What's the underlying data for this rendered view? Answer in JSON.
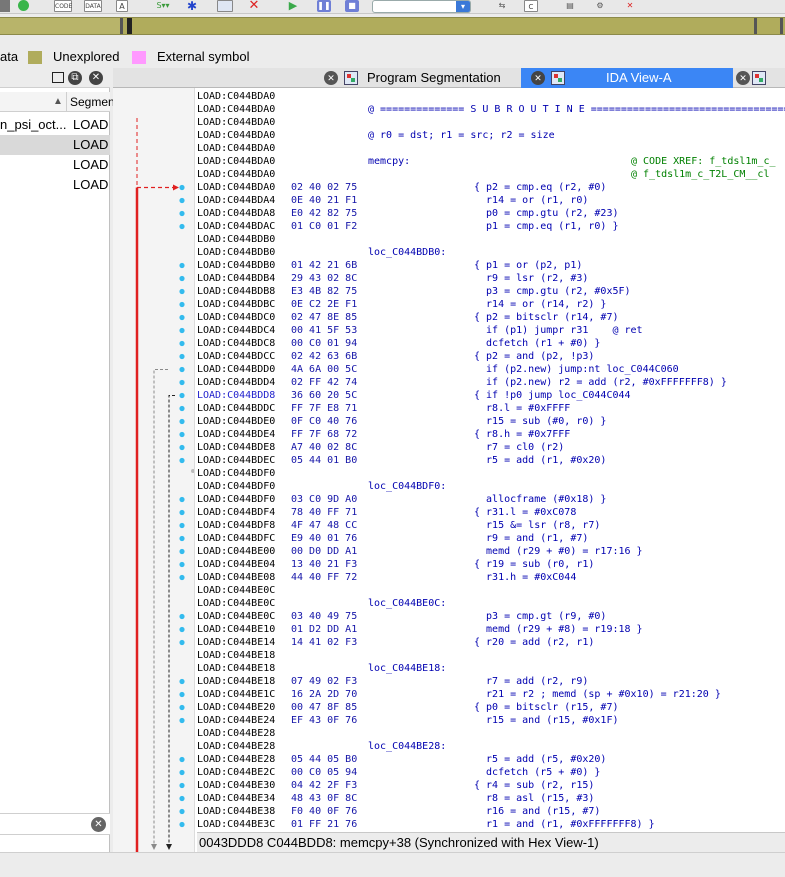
{
  "toolbar": {
    "icons": [
      "app-icon",
      "green-circle-icon",
      "code-icon",
      "data-icon",
      "text-icon",
      "script-dropdown-icon",
      "cross-ref-icon",
      "graph-icon",
      "stop-icon",
      "play-icon",
      "pause-icon",
      "pause-alt-icon",
      "debugger-dropdown",
      "attach-icon",
      "copy-icon",
      "notes-icon",
      "settings-icon"
    ],
    "code_label": "CODE",
    "data_label": "DATA",
    "debugger_value": ""
  },
  "legend": {
    "items": [
      {
        "label": "ata",
        "color": ""
      },
      {
        "label": "Unexplored",
        "color": "#b0ac5c"
      },
      {
        "label": "External symbol",
        "color": "#ff99ff"
      }
    ]
  },
  "segments_pane": {
    "col_name": "",
    "col_segment": "Segmen",
    "rows": [
      {
        "name": "n_psi_oct...",
        "type": "LOAD",
        "selected": false
      },
      {
        "name": "",
        "type": "LOAD",
        "selected": true
      },
      {
        "name": "",
        "type": "LOAD",
        "selected": false
      },
      {
        "name": "",
        "type": "LOAD",
        "selected": false
      }
    ]
  },
  "tabs": [
    {
      "label": "Program Segmentation",
      "active": false
    },
    {
      "label": "IDA View-A",
      "active": true
    },
    {
      "label": "",
      "active": false
    }
  ],
  "listing": [
    {
      "addr": "LOAD:C044BDA0",
      "bytes": "",
      "label": "",
      "instr": "",
      "comment": ""
    },
    {
      "addr": "LOAD:C044BDA0",
      "bytes": "",
      "label": "@ ============== S U B R O U T I N E =======================================",
      "instr": "",
      "comment": ""
    },
    {
      "addr": "LOAD:C044BDA0",
      "bytes": "",
      "label": "",
      "instr": "",
      "comment": ""
    },
    {
      "addr": "LOAD:C044BDA0",
      "bytes": "",
      "label": "@ r0 = dst; r1 = src; r2 = size",
      "instr": "",
      "comment": ""
    },
    {
      "addr": "LOAD:C044BDA0",
      "bytes": "",
      "label": "",
      "instr": "",
      "comment": ""
    },
    {
      "addr": "LOAD:C044BDA0",
      "bytes": "",
      "label": "memcpy:",
      "instr": "",
      "comment": "@ CODE XREF: f_tdsl1m_c_"
    },
    {
      "addr": "LOAD:C044BDA0",
      "bytes": "",
      "label": "",
      "instr": "",
      "comment": "@ f_tdsl1m_c_T2L_CM__cl"
    },
    {
      "addr": "LOAD:C044BDA0",
      "bytes": "02 40 02 75",
      "label": "",
      "instr": "{ p2 = cmp.eq (r2, #0)",
      "comment": ""
    },
    {
      "addr": "LOAD:C044BDA4",
      "bytes": "0E 40 21 F1",
      "label": "",
      "instr": "  r14 = or (r1, r0)",
      "comment": ""
    },
    {
      "addr": "LOAD:C044BDA8",
      "bytes": "E0 42 82 75",
      "label": "",
      "instr": "  p0 = cmp.gtu (r2, #23)",
      "comment": ""
    },
    {
      "addr": "LOAD:C044BDAC",
      "bytes": "01 C0 01 F2",
      "label": "",
      "instr": "  p1 = cmp.eq (r1, r0) }",
      "comment": ""
    },
    {
      "addr": "LOAD:C044BDB0",
      "bytes": "",
      "label": "",
      "instr": "",
      "comment": ""
    },
    {
      "addr": "LOAD:C044BDB0",
      "bytes": "",
      "label": "loc_C044BDB0:",
      "instr": "",
      "comment": ""
    },
    {
      "addr": "LOAD:C044BDB0",
      "bytes": "01 42 21 6B",
      "label": "",
      "instr": "{ p1 = or (p2, p1)",
      "comment": ""
    },
    {
      "addr": "LOAD:C044BDB4",
      "bytes": "29 43 02 8C",
      "label": "",
      "instr": "  r9 = lsr (r2, #3)",
      "comment": ""
    },
    {
      "addr": "LOAD:C044BDB8",
      "bytes": "E3 4B 82 75",
      "label": "",
      "instr": "  p3 = cmp.gtu (r2, #0x5F)",
      "comment": ""
    },
    {
      "addr": "LOAD:C044BDBC",
      "bytes": "0E C2 2E F1",
      "label": "",
      "instr": "  r14 = or (r14, r2) }",
      "comment": ""
    },
    {
      "addr": "LOAD:C044BDC0",
      "bytes": "02 47 8E 85",
      "label": "",
      "instr": "{ p2 = bitsclr (r14, #7)",
      "comment": ""
    },
    {
      "addr": "LOAD:C044BDC4",
      "bytes": "00 41 5F 53",
      "label": "",
      "instr": "  if (p1) jumpr r31    @ ret",
      "comment": ""
    },
    {
      "addr": "LOAD:C044BDC8",
      "bytes": "00 C0 01 94",
      "label": "",
      "instr": "  dcfetch (r1 + #0) }",
      "comment": ""
    },
    {
      "addr": "LOAD:C044BDCC",
      "bytes": "02 42 63 6B",
      "label": "",
      "instr": "{ p2 = and (p2, !p3)",
      "comment": ""
    },
    {
      "addr": "LOAD:C044BDD0",
      "bytes": "4A 6A 00 5C",
      "label": "",
      "instr": "  if (p2.new) jump:nt loc_C044C060",
      "comment": ""
    },
    {
      "addr": "LOAD:C044BDD4",
      "bytes": "02 FF 42 74",
      "label": "",
      "instr": "  if (p2.new) r2 = add (r2, #0xFFFFFFF8) }",
      "comment": ""
    },
    {
      "addr": "LOAD:C044BDD8",
      "bytes": "36 60 20 5C",
      "label": "",
      "instr": "{ if !p0 jump loc_C044C044",
      "comment": "",
      "current": true
    },
    {
      "addr": "LOAD:C044BDDC",
      "bytes": "FF 7F E8 71",
      "label": "",
      "instr": "  r8.l = #0xFFFF",
      "comment": ""
    },
    {
      "addr": "LOAD:C044BDE0",
      "bytes": "0F C0 40 76",
      "label": "",
      "instr": "  r15 = sub (#0, r0) }",
      "comment": ""
    },
    {
      "addr": "LOAD:C044BDE4",
      "bytes": "FF 7F 68 72",
      "label": "",
      "instr": "{ r8.h = #0x7FFF",
      "comment": ""
    },
    {
      "addr": "LOAD:C044BDE8",
      "bytes": "A7 40 02 8C",
      "label": "",
      "instr": "  r7 = cl0 (r2)",
      "comment": ""
    },
    {
      "addr": "LOAD:C044BDEC",
      "bytes": "05 44 01 B0",
      "label": "",
      "instr": "  r5 = add (r1, #0x20)",
      "comment": ""
    },
    {
      "addr": "LOAD:C044BDF0",
      "bytes": "",
      "label": "",
      "instr": "",
      "comment": ""
    },
    {
      "addr": "LOAD:C044BDF0",
      "bytes": "",
      "label": "loc_C044BDF0:",
      "instr": "",
      "comment": ""
    },
    {
      "addr": "LOAD:C044BDF0",
      "bytes": "03 C0 9D A0",
      "label": "",
      "instr": "  allocframe (#0x18) }",
      "comment": ""
    },
    {
      "addr": "LOAD:C044BDF4",
      "bytes": "78 40 FF 71",
      "label": "",
      "instr": "{ r31.l = #0xC078",
      "comment": ""
    },
    {
      "addr": "LOAD:C044BDF8",
      "bytes": "4F 47 48 CC",
      "label": "",
      "instr": "  r15 &= lsr (r8, r7)",
      "comment": ""
    },
    {
      "addr": "LOAD:C044BDFC",
      "bytes": "E9 40 01 76",
      "label": "",
      "instr": "  r9 = and (r1, #7)",
      "comment": ""
    },
    {
      "addr": "LOAD:C044BE00",
      "bytes": "00 D0 DD A1",
      "label": "",
      "instr": "  memd (r29 + #0) = r17:16 }",
      "comment": ""
    },
    {
      "addr": "LOAD:C044BE04",
      "bytes": "13 40 21 F3",
      "label": "",
      "instr": "{ r19 = sub (r0, r1)",
      "comment": ""
    },
    {
      "addr": "LOAD:C044BE08",
      "bytes": "44 40 FF 72",
      "label": "",
      "instr": "  r31.h = #0xC044",
      "comment": ""
    },
    {
      "addr": "LOAD:C044BE0C",
      "bytes": "",
      "label": "",
      "instr": "",
      "comment": ""
    },
    {
      "addr": "LOAD:C044BE0C",
      "bytes": "",
      "label": "loc_C044BE0C:",
      "instr": "",
      "comment": ""
    },
    {
      "addr": "LOAD:C044BE0C",
      "bytes": "03 40 49 75",
      "label": "",
      "instr": "  p3 = cmp.gt (r9, #0)",
      "comment": ""
    },
    {
      "addr": "LOAD:C044BE10",
      "bytes": "01 D2 DD A1",
      "label": "",
      "instr": "  memd (r29 + #8) = r19:18 }",
      "comment": ""
    },
    {
      "addr": "LOAD:C044BE14",
      "bytes": "14 41 02 F3",
      "label": "",
      "instr": "{ r20 = add (r2, r1)",
      "comment": ""
    },
    {
      "addr": "LOAD:C044BE18",
      "bytes": "",
      "label": "",
      "instr": "",
      "comment": ""
    },
    {
      "addr": "LOAD:C044BE18",
      "bytes": "",
      "label": "loc_C044BE18:",
      "instr": "",
      "comment": ""
    },
    {
      "addr": "LOAD:C044BE18",
      "bytes": "07 49 02 F3",
      "label": "",
      "instr": "  r7 = add (r2, r9)",
      "comment": ""
    },
    {
      "addr": "LOAD:C044BE1C",
      "bytes": "16 2A 2D 70",
      "label": "",
      "instr": "  r21 = r2 ; memd (sp + #0x10) = r21:20 }",
      "comment": ""
    },
    {
      "addr": "LOAD:C044BE20",
      "bytes": "00 47 8F 85",
      "label": "",
      "instr": "{ p0 = bitsclr (r15, #7)",
      "comment": ""
    },
    {
      "addr": "LOAD:C044BE24",
      "bytes": "EF 43 0F 76",
      "label": "",
      "instr": "  r15 = and (r15, #0x1F)",
      "comment": ""
    },
    {
      "addr": "LOAD:C044BE28",
      "bytes": "",
      "label": "",
      "instr": "",
      "comment": ""
    },
    {
      "addr": "LOAD:C044BE28",
      "bytes": "",
      "label": "loc_C044BE28:",
      "instr": "",
      "comment": ""
    },
    {
      "addr": "LOAD:C044BE28",
      "bytes": "05 44 05 B0",
      "label": "",
      "instr": "  r5 = add (r5, #0x20)",
      "comment": ""
    },
    {
      "addr": "LOAD:C044BE2C",
      "bytes": "00 C0 05 94",
      "label": "",
      "instr": "  dcfetch (r5 + #0) }",
      "comment": ""
    },
    {
      "addr": "LOAD:C044BE30",
      "bytes": "04 42 2F F3",
      "label": "",
      "instr": "{ r4 = sub (r2, r15)",
      "comment": ""
    },
    {
      "addr": "LOAD:C044BE34",
      "bytes": "48 43 0F 8C",
      "label": "",
      "instr": "  r8 = asl (r15, #3)",
      "comment": ""
    },
    {
      "addr": "LOAD:C044BE38",
      "bytes": "F0 40 0F 76",
      "label": "",
      "instr": "  r16 = and (r15, #7)",
      "comment": ""
    },
    {
      "addr": "LOAD:C044BE3C",
      "bytes": "01 FF 21 76",
      "label": "",
      "instr": "  r1 = and (r1, #0xFFFFFFF8) }",
      "comment": ""
    }
  ],
  "status": {
    "text": "0043DDD8  C044BDD8: memcpy+38  (Synchronized with Hex View-1)"
  },
  "colors": {
    "arrow_main": "#e02020",
    "arrow_dashed": "#8a8a8a",
    "dot": "#33bbee",
    "active_tab": "#3b86f5"
  }
}
